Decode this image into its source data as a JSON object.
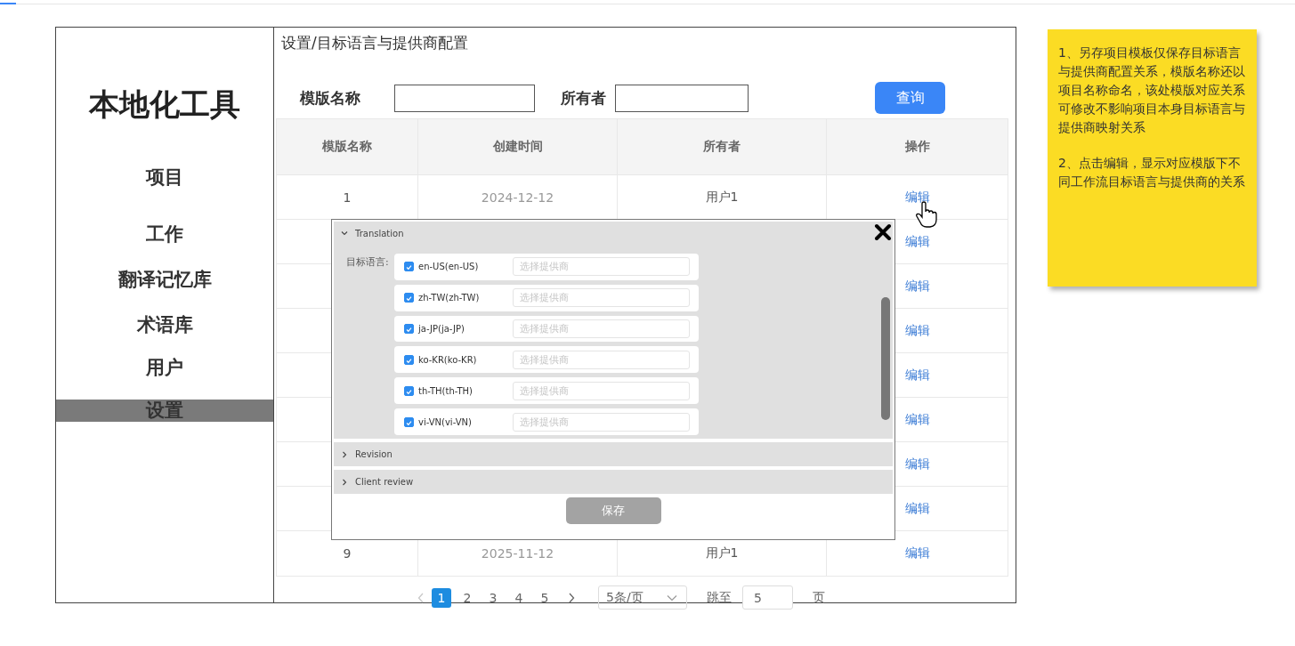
{
  "sidebar": {
    "title": "本地化工具",
    "items": [
      {
        "label": "项目",
        "selected": false
      },
      {
        "label": "工作",
        "selected": false
      },
      {
        "label": "翻译记忆库",
        "selected": false
      },
      {
        "label": "术语库",
        "selected": false
      },
      {
        "label": "用户",
        "selected": false
      },
      {
        "label": "设置",
        "selected": true
      }
    ]
  },
  "breadcrumb": "设置/目标语言与提供商配置",
  "filters": [
    {
      "label": "模版名称"
    },
    {
      "label": "所有者"
    }
  ],
  "query_button": "查询",
  "table": {
    "columns": [
      "模版名称",
      "创建时间",
      "所有者",
      "操作"
    ],
    "rows": [
      {
        "cells": [
          "1",
          "2024-12-12",
          "用户1"
        ],
        "action": "编辑"
      },
      {
        "action": "编辑"
      },
      {
        "action": "编辑"
      },
      {
        "action": "编辑"
      },
      {
        "action": "编辑"
      },
      {
        "action": "编辑"
      },
      {
        "action": "编辑"
      },
      {
        "action": "编辑"
      },
      {
        "cells": [
          "9",
          "2025-11-12",
          "用户1"
        ],
        "action": "编辑"
      }
    ]
  },
  "pagination": {
    "pages": [
      {
        "label": "1",
        "selected": true
      },
      {
        "label": "2",
        "selected": false
      },
      {
        "label": "3",
        "selected": false
      },
      {
        "label": "4",
        "selected": false
      },
      {
        "label": "5",
        "selected": false
      }
    ],
    "page_size": "5条/页",
    "jump_label": "跳至",
    "jump_value": "5",
    "page_unit": "页"
  },
  "modal": {
    "sections": [
      {
        "title": "Translation",
        "expanded": true,
        "field_label": "目标语言:",
        "languages": [
          {
            "label": "en-US(en-US)",
            "checked": true,
            "placeholder": "选择提供商"
          },
          {
            "label": "zh-TW(zh-TW)",
            "checked": true,
            "placeholder": "选择提供商"
          },
          {
            "label": "ja-JP(ja-JP)",
            "checked": true,
            "placeholder": "选择提供商"
          },
          {
            "label": "ko-KR(ko-KR)",
            "checked": true,
            "placeholder": "选择提供商"
          },
          {
            "label": "th-TH(th-TH)",
            "checked": true,
            "placeholder": "选择提供商"
          },
          {
            "label": "vi-VN(vi-VN)",
            "checked": true,
            "placeholder": "选择提供商"
          }
        ]
      },
      {
        "title": "Revision",
        "expanded": false
      },
      {
        "title": "Client review",
        "expanded": false
      }
    ],
    "save_button": "保存"
  },
  "note": {
    "paragraphs": [
      "1、另存项目模板仅保存目标语言与提供商配置关系，模版名称还以项目名称命名，该处模版对应关系可修改不影响项目本身目标语言与提供商映射关系",
      "2、点击编辑，显示对应模版下不同工作流目标语言与提供商的关系"
    ]
  }
}
